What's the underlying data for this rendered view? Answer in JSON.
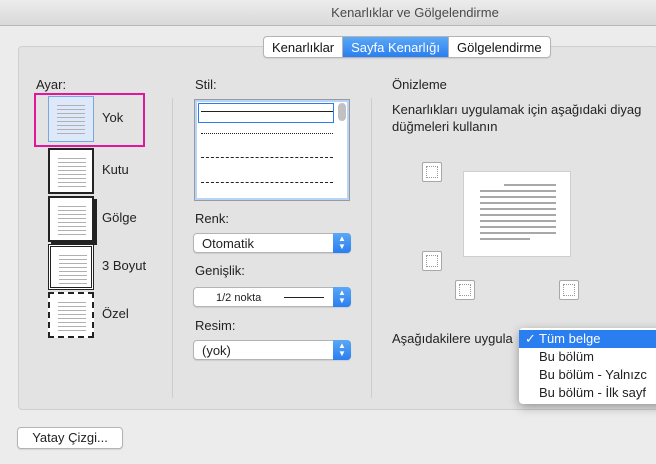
{
  "window": {
    "title": "Kenarlıklar ve Gölgelendirme"
  },
  "tabs": [
    {
      "label": "Kenarlıklar",
      "active": false
    },
    {
      "label": "Sayfa Kenarlığı",
      "active": true
    },
    {
      "label": "Gölgelendirme",
      "active": false
    }
  ],
  "setting": {
    "label": "Ayar:",
    "options": [
      {
        "name": "Yok",
        "selected": true
      },
      {
        "name": "Kutu",
        "selected": false
      },
      {
        "name": "Gölge",
        "selected": false
      },
      {
        "name": "3 Boyut",
        "selected": false
      },
      {
        "name": "Özel",
        "selected": false
      }
    ]
  },
  "style": {
    "label": "Stil:"
  },
  "color": {
    "label": "Renk:",
    "value": "Otomatik"
  },
  "width": {
    "label": "Genişlik:",
    "value": "1/2 nokta"
  },
  "art": {
    "label": "Resim:",
    "value": "(yok)"
  },
  "preview": {
    "label": "Önizleme",
    "instruction": "Kenarlıkları uygulamak için aşağıdaki diyag",
    "instruction2": "düğmeleri kullanın"
  },
  "apply_to": {
    "label": "Aşağıdakilere uygula",
    "options": [
      "Tüm belge",
      "Bu bölüm",
      "Bu bölüm - Yalnızc",
      "Bu bölüm - İlk sayf"
    ],
    "selected": "Tüm belge"
  },
  "horizontal_line_button": "Yatay Çizgi...",
  "colors": {
    "accent": "#2a7ef0",
    "highlight": "#e0169c"
  }
}
